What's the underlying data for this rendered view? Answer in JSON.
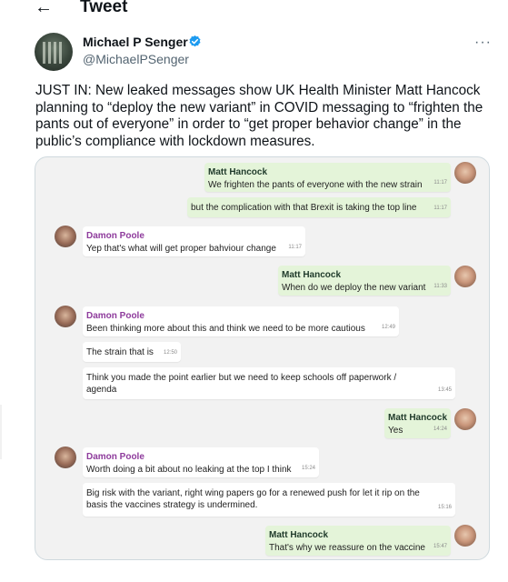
{
  "header": {
    "back_icon": "arrow-left-icon",
    "title": "Tweet"
  },
  "author": {
    "name": "Michael P Senger",
    "handle": "@MichaelPSenger",
    "verified": true,
    "verified_color": "#1d9bf0",
    "more_label": "···"
  },
  "tweet": {
    "text": "JUST IN: New leaked messages show UK Health Minister Matt Hancock planning to “deploy the new variant” in COVID messaging to “frighten the pants out of everyone” in order to “get proper behavior change” in the public’s compliance with lockdown measures."
  },
  "chat": {
    "messages": [
      {
        "sender": "Matt Hancock",
        "text": "We frighten the pants of everyone with the new strain",
        "time": "11:17"
      },
      {
        "sender": "",
        "text": "but the complication with that Brexit is taking the top line",
        "time": "11:17"
      },
      {
        "sender": "Damon Poole",
        "text": "Yep that's what will get proper bahviour change",
        "time": "11:17"
      },
      {
        "sender": "Matt Hancock",
        "text": "When do we deploy the new variant",
        "time": "11:33"
      },
      {
        "sender": "Damon Poole",
        "text": "Been thinking more about this and think we need to be more cautious",
        "time": "12:49"
      },
      {
        "sender": "",
        "text": "The strain that is",
        "time": "12:50"
      },
      {
        "sender": "",
        "text": "Think you made the point earlier but we need to keep schools off paperwork / agenda",
        "time": "13:45"
      },
      {
        "sender": "Matt Hancock",
        "text": "Yes",
        "time": "14:24"
      },
      {
        "sender": "Damon Poole",
        "text": "Worth doing a bit about no leaking at the top I think",
        "time": "15:24"
      },
      {
        "sender": "",
        "text": "Big risk with the variant, right wing papers go for a renewed push for let it rip on the basis the vaccines strategy is undermined.",
        "time": "15:16"
      },
      {
        "sender": "Matt Hancock",
        "text": "That's why we reassure on the vaccine",
        "time": "15:47"
      }
    ]
  }
}
